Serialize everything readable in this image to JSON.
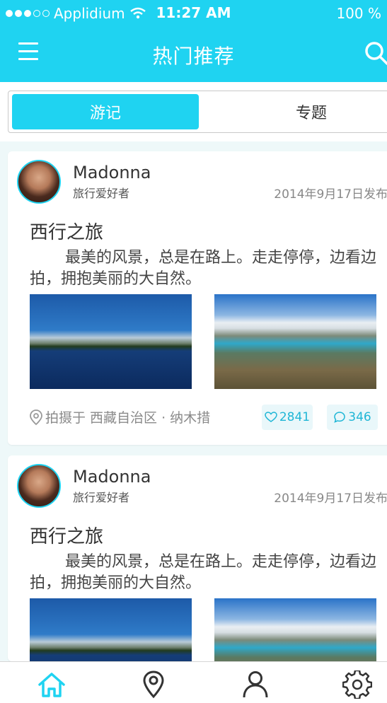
{
  "status_bar": {
    "carrier": "Applidium",
    "time": "11:27 AM",
    "battery": "100 %"
  },
  "header": {
    "title": "热门推荐"
  },
  "segments": {
    "tab1": "游记",
    "tab2": "专题"
  },
  "posts": [
    {
      "author": "Madonna",
      "role": "旅行爱好者",
      "date": "2014年9月17日发布",
      "title": "西行之旅",
      "body": "最美的风景，总是在路上。走走停停，边看边拍，拥抱美丽的大自然。",
      "location": "拍摄于 西藏自治区 · 纳木措",
      "likes": "2841",
      "comments": "346"
    },
    {
      "author": "Madonna",
      "role": "旅行爱好者",
      "date": "2014年9月17日发布",
      "title": "西行之旅",
      "body": "最美的风景，总是在路上。走走停停，边看边拍，拥抱美丽的大自然。"
    }
  ],
  "tabbar": {
    "icons": [
      "home-icon",
      "map-pin-icon",
      "user-icon",
      "gear-icon"
    ]
  },
  "colors": {
    "accent": "#1fd3f1",
    "background": "#eef8f9"
  }
}
